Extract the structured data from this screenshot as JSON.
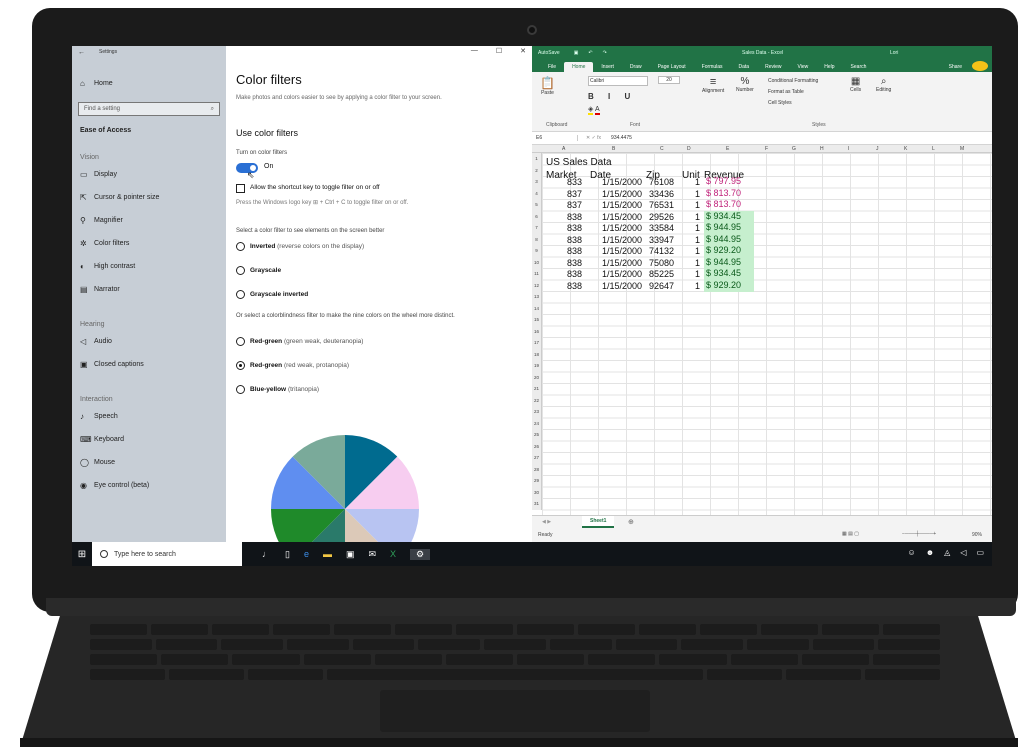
{
  "settings": {
    "window_title": "Settings",
    "nav": {
      "home": "Home",
      "search_placeholder": "Find a setting",
      "section": "Ease of Access",
      "group_vision": "Vision",
      "group_hearing": "Hearing",
      "group_interaction": "Interaction",
      "items": [
        "Display",
        "Cursor & pointer size",
        "Magnifier",
        "Color filters",
        "High contrast",
        "Narrator",
        "Audio",
        "Closed captions",
        "Speech",
        "Keyboard",
        "Mouse",
        "Eye control (beta)"
      ]
    },
    "heading": "Color filters",
    "description": "Make photos and colors easier to see by applying a color filter to your screen.",
    "subheading": "Use color filters",
    "toggle_label": "Turn on color filters",
    "toggle_state": "On",
    "shortcut_label": "Allow the shortcut key to toggle filter on or off",
    "shortcut_hint": "Press the Windows logo key ⊞ + Ctrl + C to toggle filter on or off.",
    "select_prompt": "Select a color filter to see elements on the screen better",
    "filters": [
      {
        "name": "Inverted",
        "desc": "(reverse colors on the display)"
      },
      {
        "name": "Grayscale",
        "desc": ""
      },
      {
        "name": "Grayscale inverted",
        "desc": ""
      }
    ],
    "colorblind_prompt": "Or select a colorblindness filter to make the nine colors on the wheel more distinct.",
    "colorblind_filters": [
      {
        "name": "Red-green",
        "desc": "(green weak, deuteranopia)",
        "selected": false
      },
      {
        "name": "Red-green",
        "desc": "(red weak, protanopia)",
        "selected": true
      },
      {
        "name": "Blue-yellow",
        "desc": "(tritanopia)",
        "selected": false
      }
    ],
    "wheel_colors": [
      "#006b8f",
      "#f7cdf0",
      "#b8c4f2",
      "#dcc9b8",
      "#2a7a6a",
      "#1f8a2a",
      "#5f8ef0",
      "#7aaa9a"
    ]
  },
  "excel": {
    "title_left": "AutoSave",
    "doc_title": "Sales Data - Excel",
    "user": "Lori",
    "tabs": [
      "File",
      "Home",
      "Insert",
      "Draw",
      "Page Layout",
      "Formulas",
      "Data",
      "Review",
      "View",
      "Help",
      "Search"
    ],
    "share_label": "Share",
    "ribbon": {
      "paste": "Paste",
      "clipboard": "Clipboard",
      "font_name": "Calibri",
      "font_size": "20",
      "font": "Font",
      "alignment": "Alignment",
      "number": "Number",
      "conditional": "Conditional Formatting",
      "format_table": "Format as Table",
      "cell_styles": "Cell Styles",
      "styles": "Styles",
      "cells": "Cells",
      "editing": "Editing"
    },
    "name_box": "E6",
    "formula_value": "934.4475",
    "columns": [
      "A",
      "B",
      "C",
      "D",
      "E",
      "F",
      "G",
      "H",
      "I",
      "J",
      "K",
      "L",
      "M"
    ],
    "title_cell": "US Sales Data",
    "headers": [
      "Market",
      "Date",
      "Zip",
      "Unit",
      "Revenue"
    ],
    "rows": [
      {
        "market": "833",
        "date": "1/15/2000",
        "zip": "76108",
        "unit": "1",
        "revenue": "$ 797.95",
        "tone": "red"
      },
      {
        "market": "837",
        "date": "1/15/2000",
        "zip": "33436",
        "unit": "1",
        "revenue": "$ 813.70",
        "tone": "red"
      },
      {
        "market": "837",
        "date": "1/15/2000",
        "zip": "76531",
        "unit": "1",
        "revenue": "$ 813.70",
        "tone": "red"
      },
      {
        "market": "838",
        "date": "1/15/2000",
        "zip": "29526",
        "unit": "1",
        "revenue": "$ 934.45",
        "tone": "green"
      },
      {
        "market": "838",
        "date": "1/15/2000",
        "zip": "33584",
        "unit": "1",
        "revenue": "$ 944.95",
        "tone": "green"
      },
      {
        "market": "838",
        "date": "1/15/2000",
        "zip": "33947",
        "unit": "1",
        "revenue": "$ 944.95",
        "tone": "green"
      },
      {
        "market": "838",
        "date": "1/15/2000",
        "zip": "74132",
        "unit": "1",
        "revenue": "$ 929.20",
        "tone": "green"
      },
      {
        "market": "838",
        "date": "1/15/2000",
        "zip": "75080",
        "unit": "1",
        "revenue": "$ 944.95",
        "tone": "green"
      },
      {
        "market": "838",
        "date": "1/15/2000",
        "zip": "85225",
        "unit": "1",
        "revenue": "$ 934.45",
        "tone": "green"
      },
      {
        "market": "838",
        "date": "1/15/2000",
        "zip": "92647",
        "unit": "1",
        "revenue": "$ 929.20",
        "tone": "green"
      }
    ],
    "row_numbers": [
      "1",
      "2",
      "3",
      "4",
      "5",
      "6",
      "7",
      "8",
      "9",
      "10",
      "11",
      "12",
      "13",
      "14",
      "15",
      "16",
      "17",
      "18",
      "19",
      "20",
      "21",
      "22",
      "23",
      "24",
      "25",
      "26",
      "27",
      "28",
      "29",
      "30",
      "31"
    ],
    "sheet_tab": "Sheet1",
    "status": "Ready",
    "zoom": "90%"
  },
  "taskbar": {
    "search_placeholder": "Type here to search"
  },
  "colors": {
    "excel_green": "#217346",
    "toggle_blue": "#2a6fd4",
    "settings_nav_bg": "#c7ced6",
    "revenue_red": "#c0227a",
    "revenue_green_fill": "#c6efce"
  }
}
